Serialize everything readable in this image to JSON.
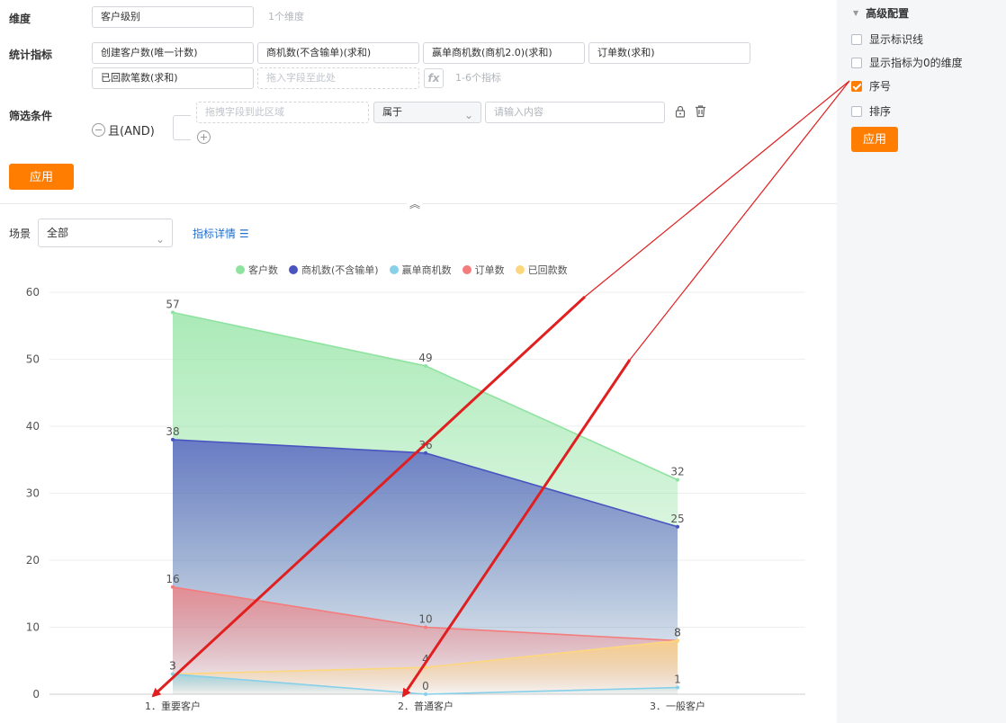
{
  "config": {
    "dimension": {
      "label": "维度",
      "value": "客户级别",
      "hint": "1个维度"
    },
    "metrics": {
      "label": "统计指标",
      "items": [
        "创建客户数(唯一计数)",
        "商机数(不含输单)(求和)",
        "赢单商机数(商机2.0)(求和)",
        "订单数(求和)",
        "已回款笔数(求和)"
      ],
      "drop_placeholder": "拖入字段至此处",
      "fx_label": "fx",
      "hint": "1-6个指标"
    },
    "filter": {
      "label": "筛选条件",
      "logic": "且(AND)",
      "field_placeholder": "拖拽字段到此区域",
      "operator": "属于",
      "value_placeholder": "请输入内容"
    },
    "apply_label": "应用"
  },
  "view": {
    "scene_label": "场景",
    "scene_value": "全部",
    "metric_detail_label": "指标详情"
  },
  "sidebar": {
    "title": "高级配置",
    "options": [
      {
        "label": "显示标识线",
        "checked": false
      },
      {
        "label": "显示指标为0的维度",
        "checked": false
      },
      {
        "label": "序号",
        "checked": true
      },
      {
        "label": "排序",
        "checked": false
      }
    ],
    "apply_label": "应用"
  },
  "colors": {
    "accent": "#ff7d00",
    "link": "#1f6fd1",
    "annotation": "#e02020"
  },
  "chart_data": {
    "type": "area",
    "categories": [
      "1．重要客户",
      "2．普通客户",
      "3．一般客户"
    ],
    "series": [
      {
        "name": "客户数",
        "values": [
          57,
          49,
          32
        ],
        "color": "#8fe3a0"
      },
      {
        "name": "商机数(不含输单)",
        "values": [
          38,
          36,
          25
        ],
        "color": "#4a54c0"
      },
      {
        "name": "赢单商机数",
        "values": [
          3,
          0,
          1
        ],
        "color": "#86d0ea"
      },
      {
        "name": "订单数",
        "values": [
          16,
          10,
          8
        ],
        "color": "#f47c7c"
      },
      {
        "name": "已回款数",
        "values": [
          3,
          4,
          8
        ],
        "color": "#fdd77e"
      }
    ],
    "yticks": [
      0,
      10,
      20,
      30,
      40,
      50,
      60
    ],
    "ylim": [
      0,
      60
    ],
    "grid": true,
    "legend": "top"
  }
}
